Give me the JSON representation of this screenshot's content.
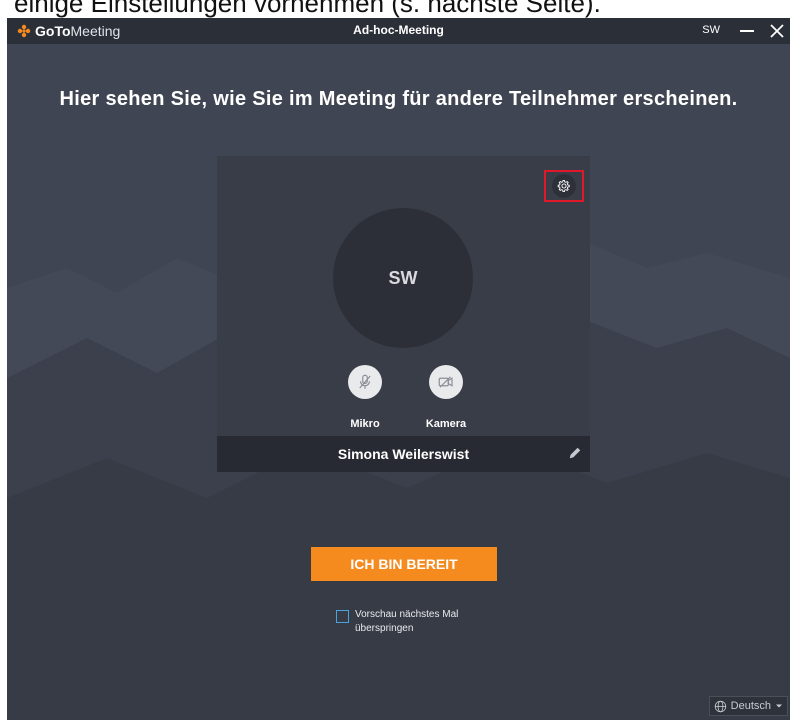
{
  "document": {
    "caption": "einige Einstellungen vornehmen (s. nächste Seite)."
  },
  "titlebar": {
    "brand_bold": "GoTo",
    "brand_light": "Meeting",
    "window_title": "Ad-hoc-Meeting",
    "user_initials": "SW"
  },
  "main": {
    "headline": "Hier sehen Sie, wie Sie im Meeting für andere Teilnehmer erscheinen.",
    "preview": {
      "avatar_initials": "SW",
      "mic_label": "Mikro",
      "camera_label": "Kamera",
      "participant_name": "Simona Weilerswist"
    },
    "ready_button": "ICH BIN BEREIT",
    "skip_preview_label": "Vorschau nächstes Mal überspringen",
    "skip_preview_checked": false,
    "language": "Deutsch"
  },
  "colors": {
    "background": "#3f4552",
    "titlebar": "#2b2f38",
    "accent_orange": "#f58a1f",
    "highlight_red": "#e0192a"
  },
  "icons": [
    "gotomeeting-logo-icon",
    "minimize-icon",
    "close-icon",
    "gear-icon",
    "mic-muted-icon",
    "camera-off-icon",
    "pencil-icon",
    "globe-icon",
    "dropdown-arrow-icon"
  ]
}
